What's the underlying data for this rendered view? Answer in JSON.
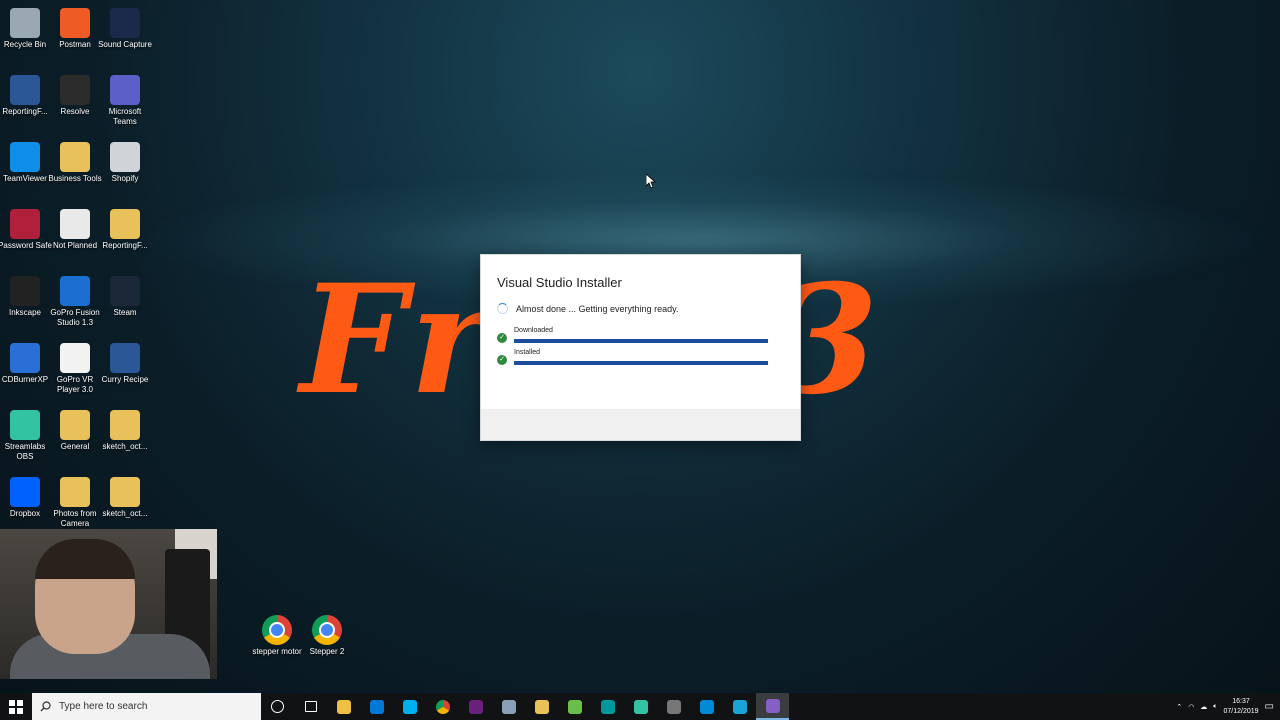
{
  "desktop_icons": [
    {
      "label": "Recycle Bin",
      "icon": "recycle-bin-icon",
      "color": "#9aa8b2"
    },
    {
      "label": "Postman",
      "icon": "postman-icon",
      "color": "#ef5b25"
    },
    {
      "label": "Sound Capture",
      "icon": "sound-capture-icon",
      "color": "#1b2a4a"
    },
    {
      "label": "ReportingF...",
      "icon": "word-doc-icon",
      "color": "#2b5797"
    },
    {
      "label": "Resolve",
      "icon": "resolve-icon",
      "color": "#2c2c2c"
    },
    {
      "label": "Microsoft Teams",
      "icon": "teams-icon",
      "color": "#5b5fc7"
    },
    {
      "label": "TeamViewer",
      "icon": "teamviewer-icon",
      "color": "#0e8ee9"
    },
    {
      "label": "Business Tools",
      "icon": "folder-icon",
      "color": "#e8c15a"
    },
    {
      "label": "Shopify",
      "icon": "shopify-icon",
      "color": "#d0d4d8"
    },
    {
      "label": "Password Safe",
      "icon": "password-safe-icon",
      "color": "#b0203a"
    },
    {
      "label": "Not Planned",
      "icon": "text-file-icon",
      "color": "#e9e9e9"
    },
    {
      "label": "ReportingF...",
      "icon": "folder-zip-icon",
      "color": "#e8c15a"
    },
    {
      "label": "Inkscape",
      "icon": "inkscape-icon",
      "color": "#222222"
    },
    {
      "label": "GoPro Fusion Studio 1.3",
      "icon": "gopro-fusion-icon",
      "color": "#1a6fd1"
    },
    {
      "label": "Steam",
      "icon": "steam-icon",
      "color": "#1b2838"
    },
    {
      "label": "CDBurnerXP",
      "icon": "cdburner-icon",
      "color": "#2a6fd6"
    },
    {
      "label": "GoPro VR Player 3.0",
      "icon": "blank-file-icon",
      "color": "#f2f2f2"
    },
    {
      "label": "Curry Recipe",
      "icon": "word-doc-icon",
      "color": "#2b5797"
    },
    {
      "label": "Streamlabs OBS",
      "icon": "streamlabs-icon",
      "color": "#31c3a2"
    },
    {
      "label": "General",
      "icon": "folder-icon",
      "color": "#e8c15a"
    },
    {
      "label": "sketch_oct...",
      "icon": "folder-icon",
      "color": "#e8c15a"
    },
    {
      "label": "Dropbox",
      "icon": "dropbox-icon",
      "color": "#0061ff"
    },
    {
      "label": "Photos from Camera",
      "icon": "folder-photos-icon",
      "color": "#e8c15a"
    },
    {
      "label": "sketch_oct...",
      "icon": "folder-icon",
      "color": "#e8c15a"
    },
    {
      "label": "stepper motor",
      "icon": "chrome-icon",
      "color": "#db4437"
    },
    {
      "label": "Stepper 2",
      "icon": "chrome-icon",
      "color": "#db4437"
    }
  ],
  "brand_text": "Fr      123",
  "installer": {
    "title": "Visual Studio Installer",
    "status": "Almost done ... Getting everything ready.",
    "steps": [
      {
        "label": "Downloaded",
        "progress": 1.0
      },
      {
        "label": "Installed",
        "progress": 1.0
      }
    ]
  },
  "taskbar": {
    "search_placeholder": "Type here to search",
    "apps": [
      {
        "icon": "cortana-icon",
        "color": "#ffffff"
      },
      {
        "icon": "task-view-icon",
        "color": "#ffffff"
      },
      {
        "icon": "file-explorer-icon",
        "color": "#f0c040"
      },
      {
        "icon": "store-icon",
        "color": "#0078d7"
      },
      {
        "icon": "skype-icon",
        "color": "#00aff0"
      },
      {
        "icon": "chrome-icon",
        "color": "#db4437"
      },
      {
        "icon": "visual-studio-icon",
        "color": "#68217a"
      },
      {
        "icon": "app-icon",
        "color": "#8aa0b8"
      },
      {
        "icon": "folder-icon",
        "color": "#e8c15a"
      },
      {
        "icon": "notepad-icon",
        "color": "#6abf4b"
      },
      {
        "icon": "arduino-icon",
        "color": "#00979d"
      },
      {
        "icon": "streamlabs-icon",
        "color": "#31c3a2"
      },
      {
        "icon": "resolve-icon",
        "color": "#777777"
      },
      {
        "icon": "azure-icon",
        "color": "#0089d6"
      },
      {
        "icon": "ccleaner-icon",
        "color": "#1aa3d6"
      },
      {
        "icon": "visual-studio-installer-icon",
        "color": "#865fc5"
      }
    ],
    "time": "16:37",
    "date": "07/12/2019"
  }
}
